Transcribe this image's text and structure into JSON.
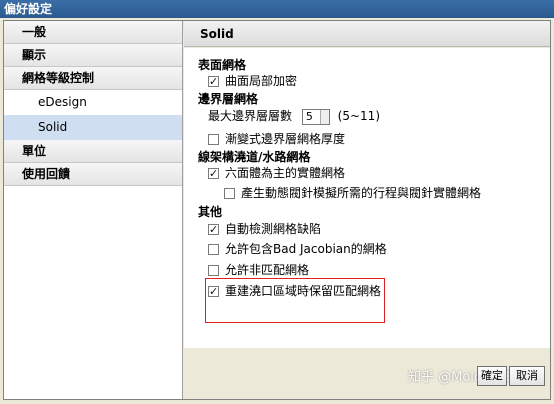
{
  "window": {
    "title": "偏好設定"
  },
  "sidebar": {
    "items": [
      {
        "label": "一般"
      },
      {
        "label": "顯示"
      },
      {
        "label": "網格等級控制"
      },
      {
        "label": "eDesign"
      },
      {
        "label": "Solid"
      },
      {
        "label": "單位"
      },
      {
        "label": "使用回饋"
      }
    ],
    "selected": "Solid"
  },
  "panel": {
    "title": "Solid",
    "sections": {
      "surface": {
        "label": "表面網格",
        "local_refine": {
          "label": "曲面局部加密",
          "checked": true
        }
      },
      "boundary": {
        "label": "邊界層網格",
        "max_layers_label": "最大邊界層層數",
        "max_layers_value": "5",
        "max_layers_range": "(5~11)",
        "gradual_thickness": {
          "label": "漸變式邊界層網格厚度",
          "checked": false
        }
      },
      "runner": {
        "label": "線架構澆道/水路網格",
        "hexa_solid": {
          "label": "六面體為主的實體網格",
          "checked": true
        },
        "dynamic_pin": {
          "label": "產生動態閥針模擬所需的行程與閥針實體網格",
          "checked": false
        }
      },
      "other": {
        "label": "其他",
        "auto_detect": {
          "label": "自動檢測網格缺陷",
          "checked": true
        },
        "bad_jacobian": {
          "label": "允許包含Bad Jacobian的網格",
          "checked": false
        },
        "non_matching": {
          "label": "允許非匹配網格",
          "checked": false
        },
        "keep_matching": {
          "label": "重建澆口區域時保留匹配網格",
          "checked": true
        }
      }
    }
  },
  "buttons": {
    "ok": "確定",
    "cancel": "取消"
  },
  "watermark": "知乎 @Moldex3D"
}
